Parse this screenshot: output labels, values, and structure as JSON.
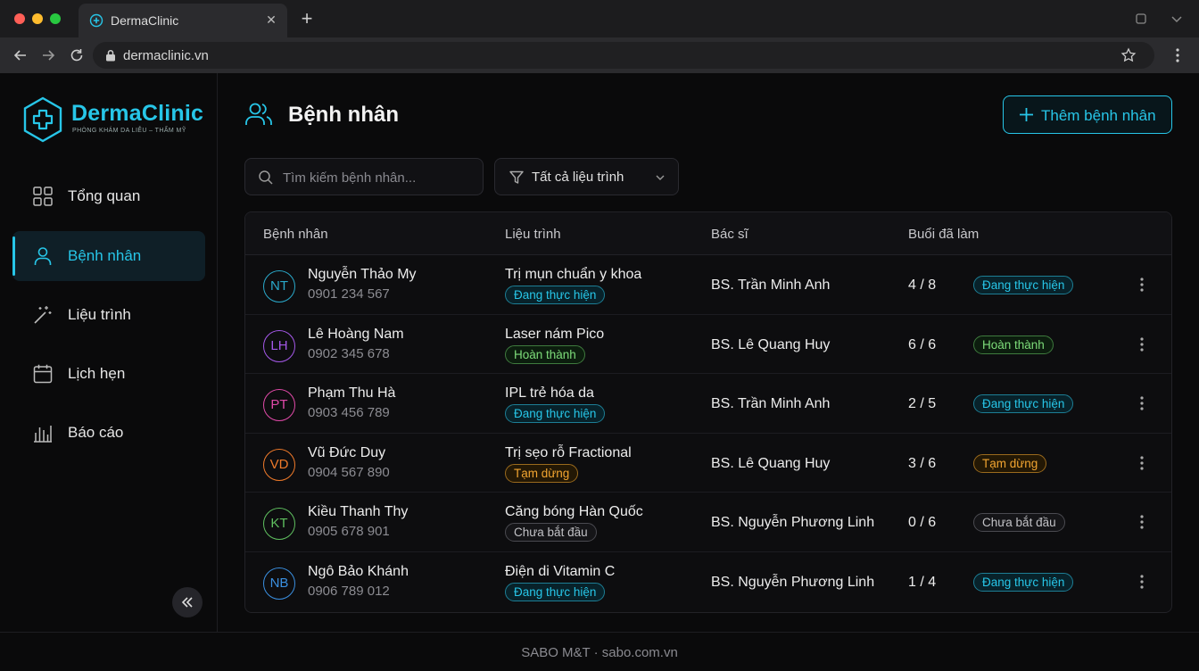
{
  "browser": {
    "tab_title": "DermaClinic",
    "url": "dermaclinic.vn"
  },
  "brand": {
    "name": "DermaClinic",
    "tagline": "PHÒNG KHÁM DA LIỄU – THẨM MỸ",
    "accent": "#27c6e8"
  },
  "sidebar": {
    "items": [
      {
        "label": "Tổng quan",
        "icon": "grid-icon"
      },
      {
        "label": "Bệnh nhân",
        "icon": "user-icon",
        "active": true
      },
      {
        "label": "Liệu trình",
        "icon": "magic-wand-icon"
      },
      {
        "label": "Lịch hẹn",
        "icon": "calendar-icon"
      },
      {
        "label": "Báo cáo",
        "icon": "bar-chart-icon"
      }
    ]
  },
  "page": {
    "title": "Bệnh nhân",
    "add_button": "Thêm bệnh nhân",
    "search_placeholder": "Tìm kiếm bệnh nhân...",
    "filter_label": "Tất cả liệu trình"
  },
  "table": {
    "headers": [
      "Bệnh nhân",
      "Liệu trình",
      "Bác sĩ",
      "Buổi đã làm"
    ],
    "rows": [
      {
        "initials": "NT",
        "name": "Nguyễn Thảo My",
        "phone": "0901 234 567",
        "course": "Trị mụn chuẩn y khoa",
        "course_status": "Đang thực hiện",
        "doctor": "BS. Trần Minh Anh",
        "sessions": "4 / 8",
        "status": "Đang thực hiện"
      },
      {
        "initials": "LH",
        "name": "Lê Hoàng Nam",
        "phone": "0902 345 678",
        "course": "Laser nám Pico",
        "course_status": "Hoàn thành",
        "doctor": "BS. Lê Quang Huy",
        "sessions": "6 / 6",
        "status": "Hoàn thành"
      },
      {
        "initials": "PT",
        "name": "Phạm Thu Hà",
        "phone": "0903 456 789",
        "course": "IPL trẻ hóa da",
        "course_status": "Đang thực hiện",
        "doctor": "BS. Trần Minh Anh",
        "sessions": "2 / 5",
        "status": "Đang thực hiện"
      },
      {
        "initials": "VD",
        "name": "Vũ Đức Duy",
        "phone": "0904 567 890",
        "course": "Trị sẹo rỗ Fractional",
        "course_status": "Tạm dừng",
        "doctor": "BS. Lê Quang Huy",
        "sessions": "3 / 6",
        "status": "Tạm dừng"
      },
      {
        "initials": "KT",
        "name": "Kiều Thanh Thy",
        "phone": "0905 678 901",
        "course": "Căng bóng Hàn Quốc",
        "course_status": "Chưa bắt đầu",
        "doctor": "BS. Nguyễn Phương Linh",
        "sessions": "0 / 6",
        "status": "Chưa bắt đầu"
      },
      {
        "initials": "NB",
        "name": "Ngô Bảo Khánh",
        "phone": "0906 789 012",
        "course": "Điện di Vitamin C",
        "course_status": "Đang thực hiện",
        "doctor": "BS. Nguyễn Phương Linh",
        "sessions": "1 / 4",
        "status": "Đang thực hiện"
      }
    ]
  },
  "avatar_colors": [
    "#2aa8c9",
    "#a458e8",
    "#e04aa8",
    "#ef7a2a",
    "#5fbf5f",
    "#3a8fe0"
  ],
  "status_colors": {
    "Đang thực hiện": "#27c6e8",
    "Hoàn thành": "#7ddc7a",
    "Tạm dừng": "#f2a531",
    "Chưa bắt đầu": "#c2c2c6"
  },
  "footer": {
    "text": "SABO M&T · sabo.com.vn"
  }
}
